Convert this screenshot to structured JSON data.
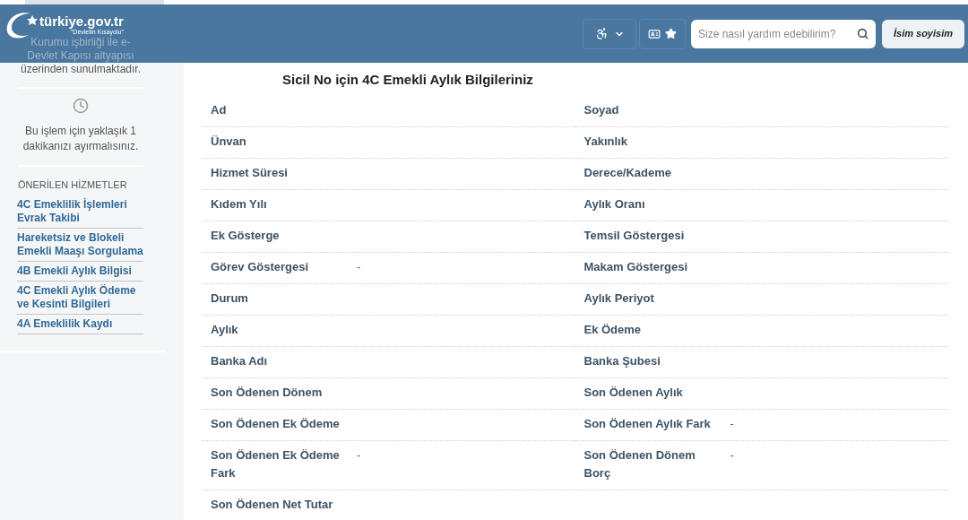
{
  "header": {
    "logo": "türkiye.gov.tr",
    "logo_tagline": "\"Devletin Kısayolu\"",
    "search": {
      "placeholder": "Size nasıl yardım edebilirim?"
    },
    "user": "İsim soyisim"
  },
  "sidebar": {
    "intro": [
      "Kurumu işbirliği ile e-",
      "Devlet Kapısı altyapısı",
      "üzerinden sunulmaktadır."
    ],
    "duration": "Bu işlem için yaklaşık 1 dakikanızı ayırmalısınız.",
    "recommended_title": "ÖNERİLEN HİZMETLER",
    "recommended": [
      "4C Emeklilik İşlemleri Evrak Takibi",
      "Hareketsiz ve Blokeli Emekli Maaşı Sorgulama",
      "4B Emekli Aylık Bilgisi",
      "4C Emekli Aylık Ödeme ve Kesinti Bilgileri",
      "4A Emeklilik Kaydı"
    ]
  },
  "title": "Sicil No için 4C Emekli Aylık Bilgileriniz",
  "rows": [
    {
      "left": {
        "label": "Ad"
      },
      "right": {
        "label": "Soyad"
      }
    },
    {
      "left": {
        "label": "Ünvan"
      },
      "right": {
        "label": "Yakınlık"
      }
    },
    {
      "left": {
        "label": "Hizmet Süresi"
      },
      "right": {
        "label": "Derece/Kademe"
      }
    },
    {
      "left": {
        "label": "Kıdem Yılı"
      },
      "right": {
        "label": "Aylık Oranı"
      }
    },
    {
      "left": {
        "label": "Ek Gösterge"
      },
      "right": {
        "label": "Temsil Göstergesi"
      }
    },
    {
      "left": {
        "label": "Görev Göstergesi",
        "value": "-"
      },
      "right": {
        "label": "Makam Göstergesi"
      }
    },
    {
      "left": {
        "label": "Durum"
      },
      "right": {
        "label": "Aylık Periyot"
      }
    },
    {
      "left": {
        "label": "Aylık"
      },
      "right": {
        "label": "Ek Ödeme"
      }
    },
    {
      "left": {
        "label": "Banka Adı"
      },
      "right": {
        "label": "Banka Şubesi"
      }
    },
    {
      "left": {
        "label": "Son Ödenen Dönem"
      },
      "right": {
        "label": "Son Ödenen Aylık"
      }
    },
    {
      "left": {
        "label": "Son Ödenen Ek Ödeme"
      },
      "right": {
        "label": "Son Ödenen Aylık Fark",
        "value": "-"
      }
    },
    {
      "left": {
        "label": "Son Ödenen Ek Ödeme Fark",
        "value": "-"
      },
      "right": {
        "label": "Son Ödenen Dönem Borç",
        "value": "-"
      }
    },
    {
      "left": {
        "label": "Son Ödenen Net Tutar"
      }
    }
  ]
}
